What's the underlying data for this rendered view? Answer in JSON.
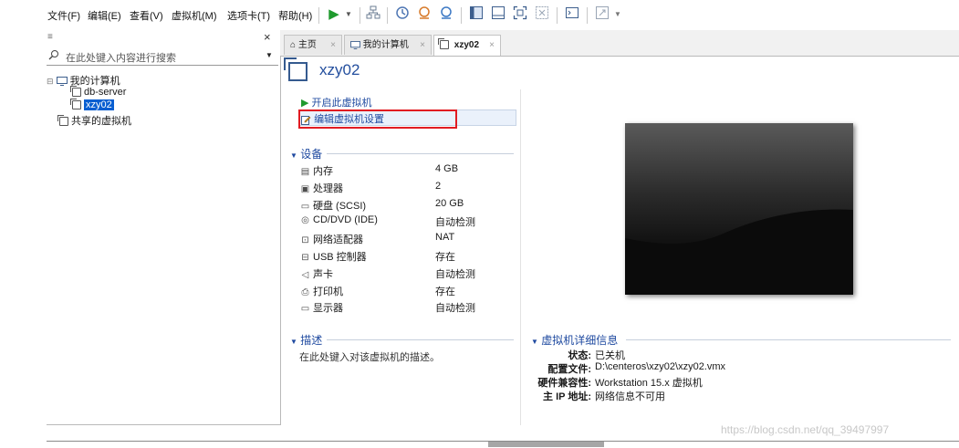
{
  "menu": {
    "items": [
      "文件(F)",
      "编辑(E)",
      "查看(V)",
      "虚拟机(M)",
      "选项卡(T)",
      "帮助(H)"
    ]
  },
  "toolbar": {
    "icons": [
      "play-icon",
      "dropdown-icon",
      "network-icon",
      "snapshot-icon",
      "snapshot-restore-icon",
      "snapshot-manager-icon",
      "library-view-icon",
      "thumbnail-view-icon",
      "fullscreen-icon",
      "unity-icon",
      "console-icon",
      "stretch-icon"
    ]
  },
  "library": {
    "close_glyph": "×",
    "search_placeholder": "在此处键入内容进行搜索",
    "tree": {
      "root": "我的计算机",
      "vms": [
        "db-server",
        "xzy02"
      ],
      "shared": "共享的虚拟机"
    }
  },
  "tabs": [
    {
      "label": "主页",
      "close": "×"
    },
    {
      "label": "我的计算机",
      "close": "×"
    },
    {
      "label": "xzy02",
      "close": "×"
    }
  ],
  "vm": {
    "title": "xzy02",
    "actions": {
      "power_on": "开启此虚拟机",
      "edit_settings": "编辑虚拟机设置"
    },
    "devices_title": "设备",
    "devices": [
      {
        "name": "内存",
        "value": "4 GB",
        "icon": "memory-icon"
      },
      {
        "name": "处理器",
        "value": "2",
        "icon": "cpu-icon"
      },
      {
        "name": "硬盘 (SCSI)",
        "value": "20 GB",
        "icon": "disk-icon"
      },
      {
        "name": "CD/DVD (IDE)",
        "value": "自动检测",
        "icon": "cd-icon"
      },
      {
        "name": "网络适配器",
        "value": "NAT",
        "icon": "network-adapter-icon"
      },
      {
        "name": "USB 控制器",
        "value": "存在",
        "icon": "usb-icon"
      },
      {
        "name": "声卡",
        "value": "自动检测",
        "icon": "sound-icon"
      },
      {
        "name": "打印机",
        "value": "存在",
        "icon": "printer-icon"
      },
      {
        "name": "显示器",
        "value": "自动检测",
        "icon": "display-icon"
      }
    ],
    "description_title": "描述",
    "description_placeholder": "在此处键入对该虚拟机的描述。",
    "details_title": "虚拟机详细信息",
    "details": [
      {
        "label": "状态:",
        "value": "已关机"
      },
      {
        "label": "配置文件:",
        "value": "D:\\centeros\\xzy02\\xzy02.vmx"
      },
      {
        "label": "硬件兼容性:",
        "value": "Workstation 15.x 虚拟机"
      },
      {
        "label": "主 IP 地址:",
        "value": "网络信息不可用"
      }
    ]
  },
  "watermark": "https://blog.csdn.net/qq_39497997",
  "colors": {
    "accent": "#1f4aa0",
    "highlight_box": "#e11b22",
    "selection": "#0a5fd1",
    "play": "#1f9a2e"
  }
}
